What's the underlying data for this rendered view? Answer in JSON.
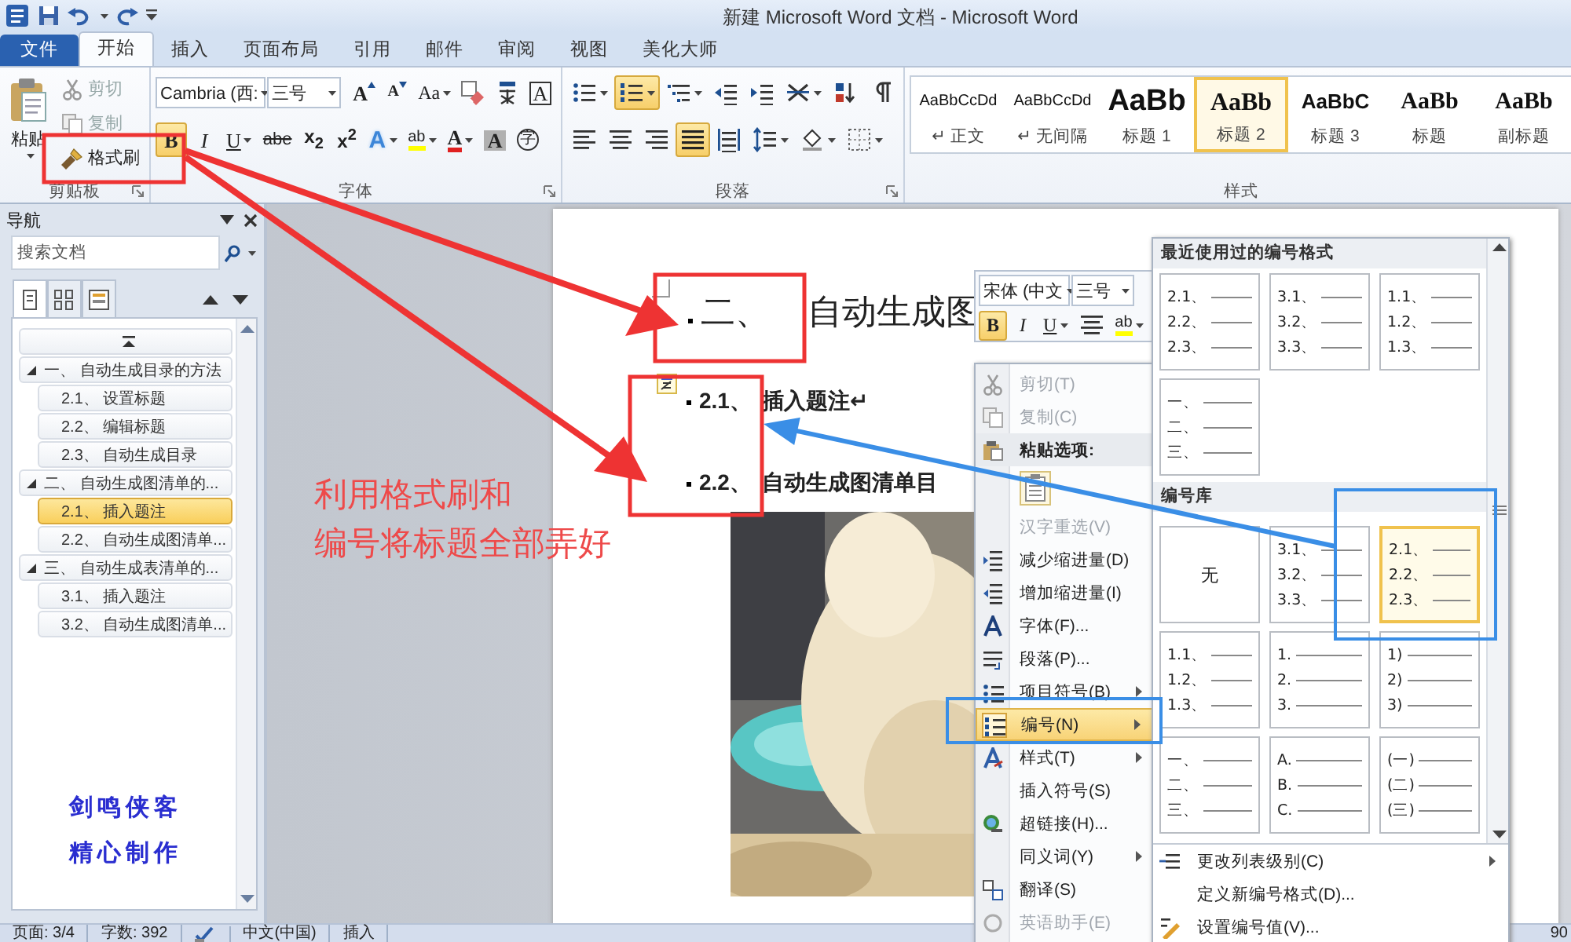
{
  "title_bar": {
    "title": "新建 Microsoft Word 文档 - Microsoft Word"
  },
  "ribbon_tabs": [
    {
      "label": "文件",
      "kind": "file",
      "selected": false
    },
    {
      "label": "开始",
      "kind": "tab",
      "selected": true
    },
    {
      "label": "插入",
      "kind": "tab",
      "selected": false
    },
    {
      "label": "页面布局",
      "kind": "tab",
      "selected": false
    },
    {
      "label": "引用",
      "kind": "tab",
      "selected": false
    },
    {
      "label": "邮件",
      "kind": "tab",
      "selected": false
    },
    {
      "label": "审阅",
      "kind": "tab",
      "selected": false
    },
    {
      "label": "视图",
      "kind": "tab",
      "selected": false
    },
    {
      "label": "美化大师",
      "kind": "tab",
      "selected": false
    }
  ],
  "clipboard": {
    "paste": "粘贴",
    "cut": {
      "label": "剪切",
      "disabled": true
    },
    "copy": {
      "label": "复制",
      "disabled": true
    },
    "format_painter": {
      "label": "格式刷",
      "disabled": false
    },
    "group_label": "剪贴板"
  },
  "font_group": {
    "font": "Cambria (西:",
    "size": "三号",
    "row1": [
      {
        "kind": "grow",
        "label": "A"
      },
      {
        "kind": "shrink",
        "label": "A"
      },
      {
        "kind": "case",
        "label": "Aa"
      },
      {
        "kind": "clear"
      },
      {
        "kind": "phonetic"
      },
      {
        "kind": "border",
        "label": "A"
      }
    ],
    "row2": [
      {
        "kind": "bold",
        "label": "B",
        "selected": true
      },
      {
        "kind": "italic",
        "label": "I",
        "selected": false
      },
      {
        "kind": "underline",
        "label": "U",
        "selected": false
      },
      {
        "kind": "strike",
        "label": "abe",
        "selected": false
      },
      {
        "kind": "sub",
        "label": "x$_{2}$",
        "selected": false
      },
      {
        "kind": "sup",
        "label": "x$^{2}$",
        "selected": false
      },
      {
        "kind": "effect",
        "label": "A",
        "selected": false
      },
      {
        "kind": "highlight",
        "label": "ab",
        "selected": false
      },
      {
        "kind": "color",
        "label": "A",
        "selected": false
      },
      {
        "kind": "shading",
        "label": "A",
        "selected": false
      },
      {
        "kind": "enclose",
        "label": "字",
        "selected": false
      }
    ],
    "group_label": "字体"
  },
  "paragraph_group": {
    "row1": [
      {
        "kind": "bullets",
        "selected": false
      },
      {
        "kind": "numbering",
        "selected": true
      },
      {
        "kind": "multilevel",
        "selected": false
      },
      {
        "kind": "outdent",
        "selected": false
      },
      {
        "kind": "indent",
        "selected": false
      },
      {
        "kind": "asian-layout",
        "selected": false
      },
      {
        "kind": "sort",
        "selected": false
      },
      {
        "kind": "marks",
        "selected": false
      }
    ],
    "row2": [
      {
        "kind": "align-left",
        "selected": false
      },
      {
        "kind": "center",
        "selected": false
      },
      {
        "kind": "align-right",
        "selected": false
      },
      {
        "kind": "justify",
        "selected": true
      },
      {
        "kind": "distribute",
        "selected": false
      },
      {
        "kind": "line-spacing",
        "selected": false
      },
      {
        "kind": "shading",
        "selected": false
      },
      {
        "kind": "borders",
        "selected": false
      }
    ],
    "group_label": "段落"
  },
  "styles_group": {
    "items": [
      {
        "sample": "AaBbCcDd",
        "label": "↵ 正文",
        "kind": "body",
        "selected": false
      },
      {
        "sample": "AaBbCcDd",
        "label": "↵ 无间隔",
        "kind": "body",
        "selected": false
      },
      {
        "sample": "AaBb",
        "label": "标题 1",
        "kind": "h1",
        "selected": false
      },
      {
        "sample": "AaBb",
        "label": "标题 2",
        "kind": "h2",
        "selected": true
      },
      {
        "sample": "AaBbC",
        "label": "标题 3",
        "kind": "h3",
        "selected": false
      },
      {
        "sample": "AaBb",
        "label": "标题",
        "kind": "title",
        "selected": false
      },
      {
        "sample": "AaBb",
        "label": "副标题",
        "kind": "subtitle",
        "selected": false
      }
    ],
    "group_label": "样式"
  },
  "nav": {
    "title": "导航",
    "search_placeholder": "搜索文档",
    "view_tabs": [
      {
        "kind": "headings",
        "selected": true
      },
      {
        "kind": "pages",
        "selected": false
      },
      {
        "kind": "results",
        "selected": false
      }
    ],
    "tree": [
      {
        "label": "一、 自动生成目录的方法",
        "expanded": true,
        "selected": false,
        "children": [
          {
            "label": "2.1、 设置标题",
            "selected": false
          },
          {
            "label": "2.2、 编辑标题",
            "selected": false
          },
          {
            "label": "2.3、 自动生成目录",
            "selected": false
          }
        ]
      },
      {
        "label": "二、 自动生成图清单的...",
        "expanded": true,
        "selected": false,
        "children": [
          {
            "label": "2.1、 插入题注",
            "selected": true
          },
          {
            "label": "2.2、 自动生成图清单...",
            "selected": false
          }
        ]
      },
      {
        "label": "三、 自动生成表清单的...",
        "expanded": true,
        "selected": false,
        "children": [
          {
            "label": "3.1、 插入题注",
            "selected": false
          },
          {
            "label": "3.2、 自动生成图清单...",
            "selected": false
          }
        ]
      }
    ],
    "signature": [
      "剑鸣侠客",
      "精心制作"
    ]
  },
  "document": {
    "heading": {
      "number": "二、",
      "text": "自动生成图"
    },
    "lines": [
      {
        "number": "2.1、",
        "text": "插入题注↵"
      },
      {
        "number": "2.2、",
        "text": "自动生成图清单目"
      }
    ]
  },
  "annotation": {
    "lines": [
      "利用格式刷和",
      "编号将标题全部弄好"
    ]
  },
  "mini_toolbar": {
    "font": "宋体 (中文",
    "size": "三号",
    "buttons": [
      {
        "kind": "bold",
        "label": "B",
        "selected": true
      },
      {
        "kind": "italic",
        "label": "I",
        "selected": false
      },
      {
        "kind": "underline",
        "label": "U",
        "selected": false
      },
      {
        "kind": "center",
        "selected": false
      },
      {
        "kind": "highlight",
        "label": "ab",
        "selected": false
      }
    ]
  },
  "context_menu": {
    "items": [
      {
        "kind": "item",
        "label": "剪切(T)",
        "disabled": true,
        "submenu": false,
        "selected": false
      },
      {
        "kind": "item",
        "label": "复制(C)",
        "disabled": true,
        "submenu": false,
        "selected": false
      },
      {
        "kind": "header",
        "label": "粘贴选项:"
      },
      {
        "kind": "paste-option"
      },
      {
        "kind": "item",
        "label": "汉字重选(V)",
        "disabled": true,
        "submenu": false,
        "selected": false
      },
      {
        "kind": "item",
        "label": "减少缩进量(D)",
        "disabled": false,
        "submenu": false,
        "selected": false
      },
      {
        "kind": "item",
        "label": "增加缩进量(I)",
        "disabled": false,
        "submenu": false,
        "selected": false
      },
      {
        "kind": "item",
        "label": "字体(F)...",
        "disabled": false,
        "submenu": false,
        "selected": false
      },
      {
        "kind": "item",
        "label": "段落(P)...",
        "disabled": false,
        "submenu": false,
        "selected": false
      },
      {
        "kind": "item",
        "label": "项目符号(B)",
        "disabled": false,
        "submenu": true,
        "selected": false
      },
      {
        "kind": "item",
        "label": "编号(N)",
        "disabled": false,
        "submenu": true,
        "selected": true
      },
      {
        "kind": "item",
        "label": "样式(T)",
        "disabled": false,
        "submenu": true,
        "selected": false
      },
      {
        "kind": "item",
        "label": "插入符号(S)",
        "disabled": false,
        "submenu": false,
        "selected": false
      },
      {
        "kind": "item",
        "label": "超链接(H)...",
        "disabled": false,
        "submenu": false,
        "selected": false
      },
      {
        "kind": "item",
        "label": "同义词(Y)",
        "disabled": false,
        "submenu": true,
        "selected": false
      },
      {
        "kind": "item",
        "label": "翻译(S)",
        "disabled": false,
        "submenu": false,
        "selected": false
      },
      {
        "kind": "item",
        "label": "英语助手(E)",
        "disabled": true,
        "submenu": false,
        "selected": false
      }
    ]
  },
  "numbering_gallery": {
    "recent_title": "最近使用过的编号格式",
    "recent": [
      {
        "kind": "list",
        "lines": [
          "2.1、",
          "2.2、",
          "2.3、"
        ],
        "selected": false
      },
      {
        "kind": "list",
        "lines": [
          "3.1、",
          "3.2、",
          "3.3、"
        ],
        "selected": false
      },
      {
        "kind": "list",
        "lines": [
          "1.1、",
          "1.2、",
          "1.3、"
        ],
        "selected": false
      },
      {
        "kind": "list",
        "lines": [
          "一、",
          "二、",
          "三、"
        ],
        "selected": false
      }
    ],
    "library_title": "编号库",
    "library": [
      {
        "kind": "none",
        "label": "无",
        "selected": false
      },
      {
        "kind": "list",
        "lines": [
          "3.1、",
          "3.2、",
          "3.3、"
        ],
        "selected": false
      },
      {
        "kind": "list",
        "lines": [
          "2.1、",
          "2.2、",
          "2.3、"
        ],
        "selected": true
      },
      {
        "kind": "list",
        "lines": [
          "1.1、",
          "1.2、",
          "1.3、"
        ],
        "selected": false
      },
      {
        "kind": "list",
        "lines": [
          "1.",
          "2.",
          "3."
        ],
        "selected": false
      },
      {
        "kind": "list",
        "lines": [
          "1)",
          "2)",
          "3)"
        ],
        "selected": false
      },
      {
        "kind": "list",
        "lines": [
          "一、",
          "二、",
          "三、"
        ],
        "selected": false
      },
      {
        "kind": "list",
        "lines": [
          "A.",
          "B.",
          "C."
        ],
        "selected": false
      },
      {
        "kind": "list",
        "lines": [
          "(一)",
          "(二)",
          "(三)"
        ],
        "selected": false
      }
    ],
    "actions": [
      {
        "label": "更改列表级别(C)",
        "submenu": true
      },
      {
        "label": "定义新编号格式(D)...",
        "submenu": false
      },
      {
        "label": "设置编号值(V)...",
        "submenu": false
      }
    ]
  },
  "status_bar": {
    "page": "页面: 3/4",
    "words": "字数: 392",
    "language": "中文(中国)",
    "mode": "插入",
    "zoom": "90"
  }
}
